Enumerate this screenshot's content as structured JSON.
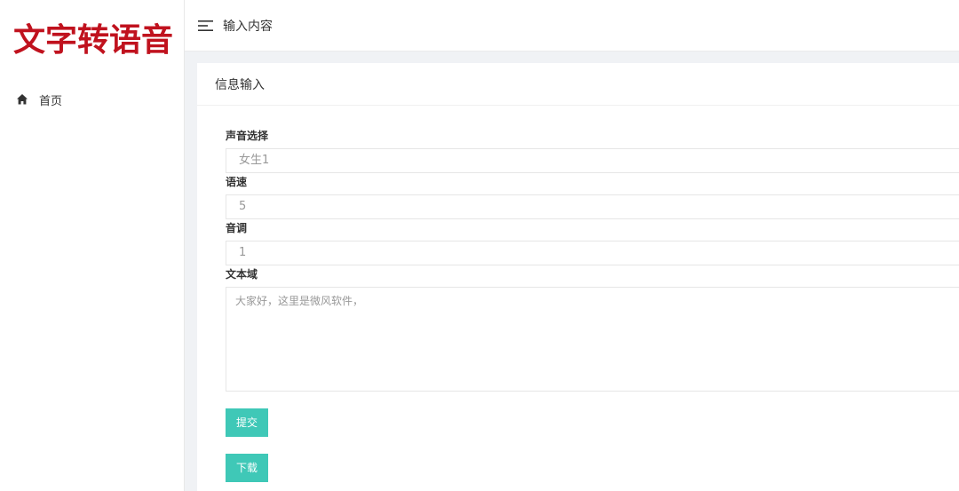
{
  "app": {
    "logo_text": "文字转语音"
  },
  "sidebar": {
    "items": [
      {
        "label": "首页",
        "icon": "home-icon"
      }
    ]
  },
  "topbar": {
    "title": "输入内容",
    "menu_icon": "menu-icon"
  },
  "card": {
    "title": "信息输入"
  },
  "form": {
    "voice": {
      "label": "声音选择",
      "value": "女生1"
    },
    "speed": {
      "label": "语速",
      "value": "5"
    },
    "pitch": {
      "label": "音调",
      "value": "1"
    },
    "text": {
      "label": "文本域",
      "value": "大家好，这里是微风软件，"
    },
    "submit_label": "提交",
    "download_label": "下载"
  },
  "colors": {
    "logo": "#c0121e",
    "button": "#3fc8b7"
  }
}
